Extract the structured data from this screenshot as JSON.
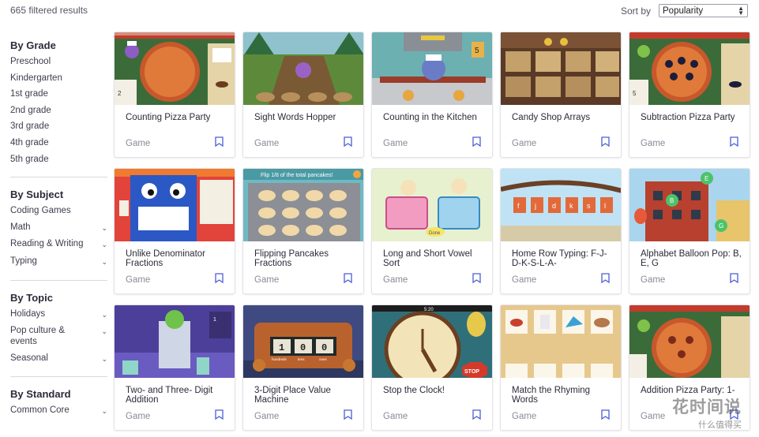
{
  "header": {
    "results_count": "665 filtered results",
    "sort_label": "Sort by",
    "sort_value": "Popularity"
  },
  "sidebar": {
    "grade": {
      "title": "By Grade",
      "items": [
        "Preschool",
        "Kindergarten",
        "1st grade",
        "2nd grade",
        "3rd grade",
        "4th grade",
        "5th grade"
      ]
    },
    "subject": {
      "title": "By Subject",
      "items": [
        {
          "label": "Coding Games",
          "expandable": false
        },
        {
          "label": "Math",
          "expandable": true
        },
        {
          "label": "Reading & Writing",
          "expandable": true
        },
        {
          "label": "Typing",
          "expandable": true
        }
      ]
    },
    "topic": {
      "title": "By Topic",
      "items": [
        {
          "label": "Holidays",
          "expandable": true
        },
        {
          "label": "Pop culture & events",
          "expandable": true
        },
        {
          "label": "Seasonal",
          "expandable": true
        }
      ]
    },
    "standard": {
      "title": "By Standard",
      "items": [
        {
          "label": "Common Core",
          "expandable": true
        }
      ]
    }
  },
  "cards": [
    {
      "title": "Counting Pizza Party",
      "type": "Game"
    },
    {
      "title": "Sight Words Hopper",
      "type": "Game"
    },
    {
      "title": "Counting in the Kitchen",
      "type": "Game"
    },
    {
      "title": "Candy Shop Arrays",
      "type": "Game"
    },
    {
      "title": "Subtraction Pizza Party",
      "type": "Game"
    },
    {
      "title": "Unlike Denominator Fractions",
      "type": "Game"
    },
    {
      "title": "Flipping Pancakes Fractions",
      "type": "Game"
    },
    {
      "title": "Long and Short Vowel Sort",
      "type": "Game"
    },
    {
      "title": "Home Row Typing: F-J-D-K-S-L-A-",
      "type": "Game"
    },
    {
      "title": "Alphabet Balloon Pop: B, E, G",
      "type": "Game"
    },
    {
      "title": "Two- and Three- Digit Addition",
      "type": "Game"
    },
    {
      "title": "3-Digit Place Value Machine",
      "type": "Game"
    },
    {
      "title": "Stop the Clock!",
      "type": "Game"
    },
    {
      "title": "Match the Rhyming Words",
      "type": "Game"
    },
    {
      "title": "Addition Pizza Party: 1-",
      "type": "Game"
    }
  ],
  "thumb_text": {
    "pancake_banner": "Flip 1/8 of the total pancakes!",
    "place_value_digits": [
      "1",
      "0",
      "0"
    ],
    "place_value_labels": [
      "hundreds",
      "tens",
      "ones"
    ],
    "clock_time": "5:20",
    "stop_sign": "STOP",
    "typing_letters": [
      "f",
      "j",
      "d",
      "k",
      "s",
      "l"
    ],
    "balloon_letters": [
      "B",
      "E",
      "G"
    ],
    "kitchen_price": "5",
    "subtraction_number": "5"
  },
  "watermark": {
    "main": "花时间说",
    "sub": "什么值得买"
  },
  "colors": {
    "accent": "#4a5ed6",
    "text": "#3d3d4e",
    "muted": "#8a8a98"
  }
}
